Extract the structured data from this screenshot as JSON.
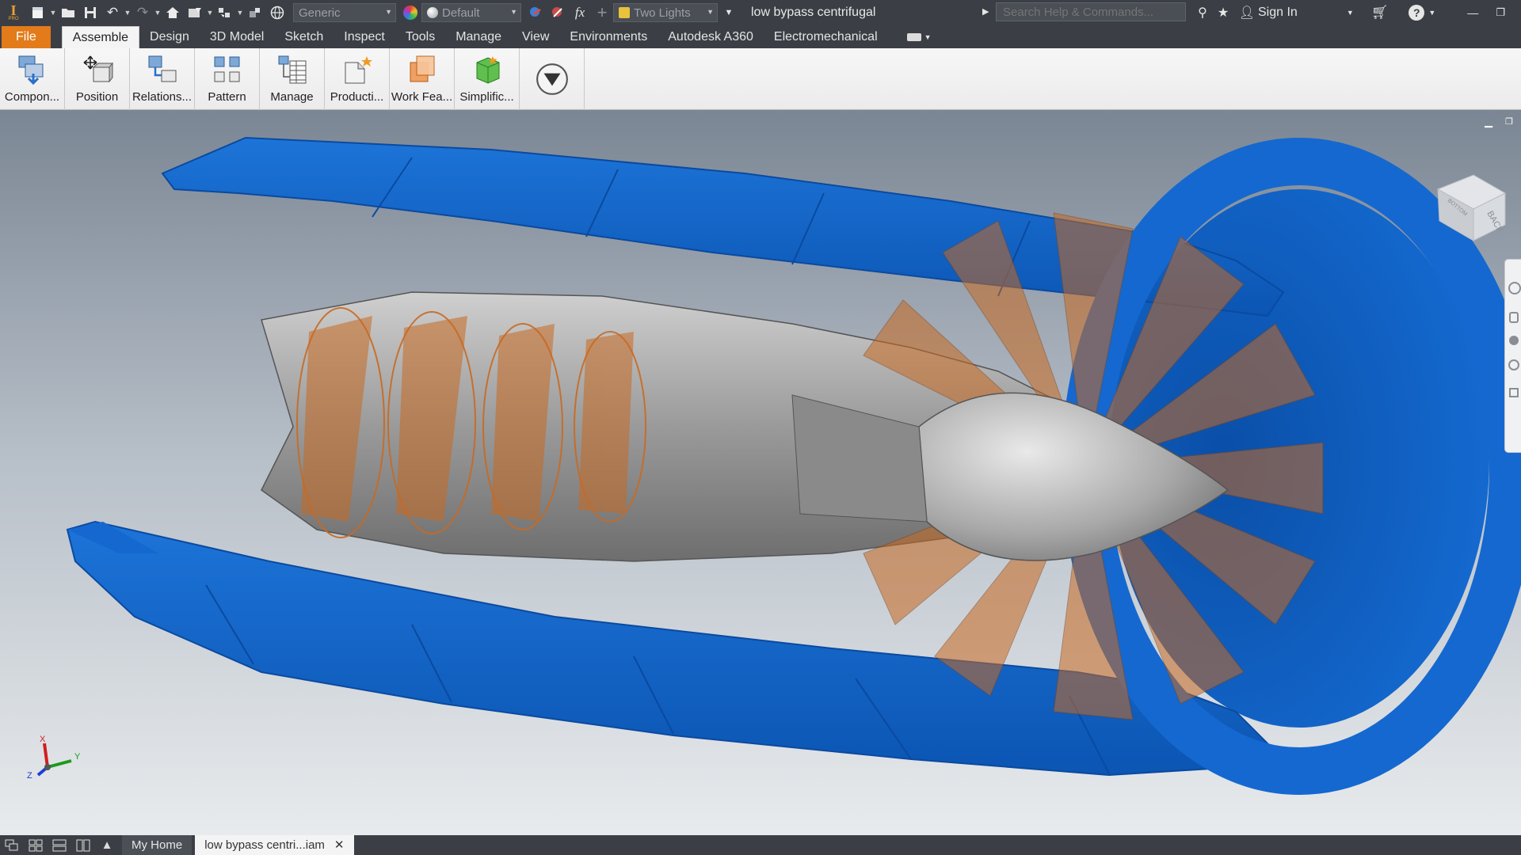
{
  "app": {
    "logo_letter": "I",
    "logo_sub": "PRO"
  },
  "quick_access": {
    "material_combo": "Generic",
    "appearance_combo": "Default",
    "lighting_combo": "Two Lights",
    "fx_label": "fx"
  },
  "document_title": "low bypass centrifugal",
  "search": {
    "placeholder": "Search Help & Commands..."
  },
  "account": {
    "sign_in": "Sign In"
  },
  "tabs": [
    {
      "label": "File"
    },
    {
      "label": "Assemble"
    },
    {
      "label": "Design"
    },
    {
      "label": "3D Model"
    },
    {
      "label": "Sketch"
    },
    {
      "label": "Inspect"
    },
    {
      "label": "Tools"
    },
    {
      "label": "Manage"
    },
    {
      "label": "View"
    },
    {
      "label": "Environments"
    },
    {
      "label": "Autodesk A360"
    },
    {
      "label": "Electromechanical"
    }
  ],
  "ribbon": {
    "buttons": [
      {
        "label": "Compon...",
        "icon": "component-place-icon"
      },
      {
        "label": "Position",
        "icon": "position-move-icon"
      },
      {
        "label": "Relations...",
        "icon": "relationships-icon"
      },
      {
        "label": "Pattern",
        "icon": "pattern-icon"
      },
      {
        "label": "Manage",
        "icon": "bill-of-materials-icon"
      },
      {
        "label": "Producti...",
        "icon": "productivity-icon"
      },
      {
        "label": "Work Fea...",
        "icon": "work-features-icon"
      },
      {
        "label": "Simplific...",
        "icon": "simplification-icon"
      }
    ]
  },
  "viewcube": {
    "face_back": "BACK",
    "face_bottom": "BOTTOM"
  },
  "triad": {
    "x": "X",
    "y": "Y",
    "z": "Z"
  },
  "bottom": {
    "tabs": [
      {
        "label": "My Home"
      },
      {
        "label": "low bypass centri...iam"
      }
    ],
    "close_symbol": "✕"
  },
  "colors": {
    "accent_file_tab": "#e37b1a",
    "nacelle_blue": "#0f63c8",
    "blade_orange": "#c86a22",
    "engine_grey": "#9a9a9a"
  }
}
